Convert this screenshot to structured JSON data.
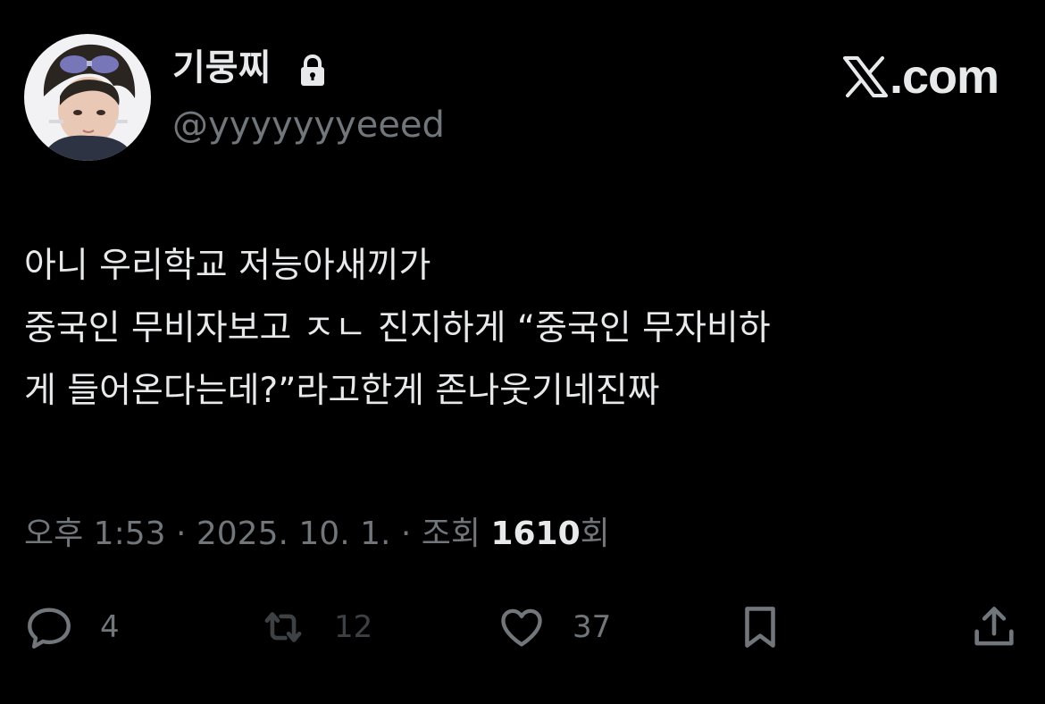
{
  "author": {
    "display_name": "기뭉찌",
    "handle": "@yyyyyyyeeed",
    "protected_icon": "lock-icon",
    "avatar": "profile-photo"
  },
  "brand": {
    "icon": "x-logo-icon",
    "text": ".com"
  },
  "tweet": {
    "lines": [
      "아니 우리학교 저능아새끼가",
      "중국인 무비자보고 ㅈㄴ 진지하게 “중국인 무자비하",
      "게 들어온다는데?”라고한게 존나웃기네진짜"
    ]
  },
  "meta": {
    "time": "오후 1:53",
    "separator1": " · ",
    "date": "2025. 10. 1.",
    "separator2": " · ",
    "views_prefix": "조회 ",
    "views_count": "1610",
    "views_suffix": "회"
  },
  "actions": {
    "reply": {
      "icon": "reply-icon",
      "count": "4"
    },
    "retweet": {
      "icon": "retweet-icon",
      "count": "12"
    },
    "like": {
      "icon": "heart-icon",
      "count": "37"
    },
    "bookmark": {
      "icon": "bookmark-icon"
    },
    "share": {
      "icon": "share-icon"
    }
  },
  "colors": {
    "background": "#000000",
    "primary_text": "#e7e9ea",
    "secondary_text": "#71767b",
    "disabled": "#3e4144"
  }
}
